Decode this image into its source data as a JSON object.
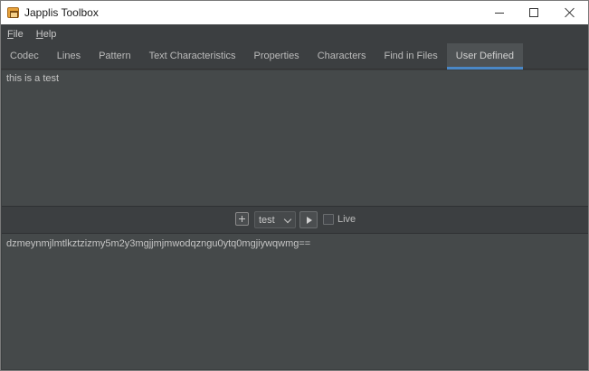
{
  "window": {
    "title": "Japplis Toolbox"
  },
  "menu": {
    "file_first": "F",
    "file_rest": "ile",
    "help_first": "H",
    "help_rest": "elp"
  },
  "tabs": [
    {
      "label": "Codec"
    },
    {
      "label": "Lines"
    },
    {
      "label": "Pattern"
    },
    {
      "label": "Text Characteristics"
    },
    {
      "label": "Properties"
    },
    {
      "label": "Characters"
    },
    {
      "label": "Find in Files"
    },
    {
      "label": "User Defined",
      "active": true
    }
  ],
  "input": {
    "value": "this is a test"
  },
  "toolbar": {
    "selected_script": "test",
    "live_label": "Live",
    "live_checked": false
  },
  "output": {
    "value": "dzmeynmjlmtlkztzizmy5m2y3mgjjmjmwodqzngu0ytq0mgjiywqwmg=="
  },
  "colors": {
    "accent": "#4a88c7",
    "background": "#3c3f41",
    "text_area": "#45494a"
  }
}
